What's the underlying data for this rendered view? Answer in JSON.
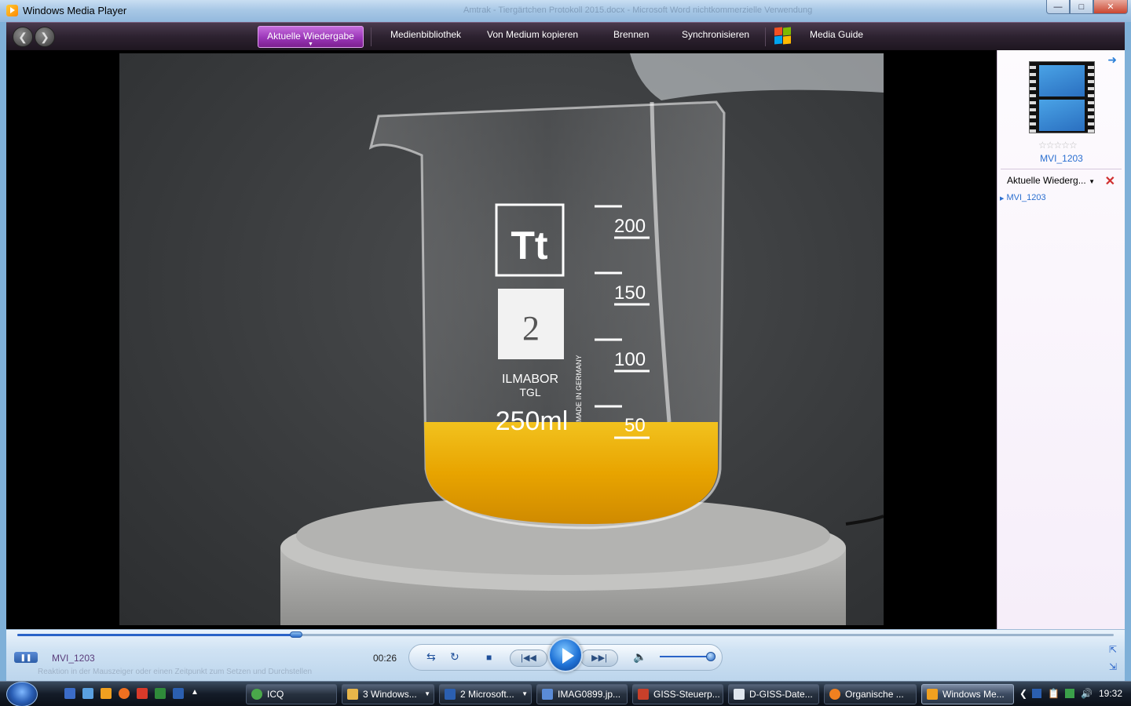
{
  "window": {
    "title": "Windows Media Player",
    "background_title": "Amtrak  -  Tiergärtchen Protokoll 2015.docx - Microsoft Word nichtkommerzielle Verwendung"
  },
  "nav": {
    "back": "back",
    "forward": "forward",
    "tabs": [
      "Aktuelle Wiedergabe",
      "Medienbibliothek",
      "Von Medium kopieren",
      "Brennen",
      "Synchronisieren",
      "Media Guide"
    ]
  },
  "video": {
    "beaker_graduations": [
      "200",
      "150",
      "100",
      "50"
    ],
    "beaker_brand": "ILMABOR",
    "beaker_tgl": "TGL",
    "beaker_volume": "250ml",
    "beaker_made_in": "MADE IN GERMANY",
    "label_number": "2",
    "colors": {
      "liquid": "#e8a400",
      "background": "#3c3e40"
    }
  },
  "rightpane": {
    "media_title": "MVI_1203",
    "rating_stars": 0,
    "playlist_header": "Aktuelle Wiederg...",
    "playlist_items": [
      "MVI_1203"
    ]
  },
  "controls": {
    "status_title": "MVI_1203",
    "time": "00:26",
    "seek_progress": 0.254,
    "volume": 0.86,
    "bg_text": "Reaktion in der Mauszeiger oder einen Zeitpunkt zum Setzen und Durchstellen"
  },
  "taskbar": {
    "items": [
      {
        "label": "ICQ",
        "color": "#4aa84a",
        "dropdown": false
      },
      {
        "label": "3 Windows...",
        "color": "#e8b64a",
        "dropdown": true
      },
      {
        "label": "2 Microsoft...",
        "color": "#2b5fb0",
        "dropdown": true
      },
      {
        "label": "IMAG0899.jp...",
        "color": "#5a8bd6",
        "dropdown": false
      },
      {
        "label": "GISS-Steuerp...",
        "color": "#c8402a",
        "dropdown": false
      },
      {
        "label": "D-GISS-Date...",
        "color": "#dfe6ee",
        "dropdown": false
      },
      {
        "label": "Organische ...",
        "color": "#f08020",
        "dropdown": false
      },
      {
        "label": "Windows Me...",
        "color": "#f0a020",
        "dropdown": false
      }
    ],
    "clock": "19:32"
  }
}
